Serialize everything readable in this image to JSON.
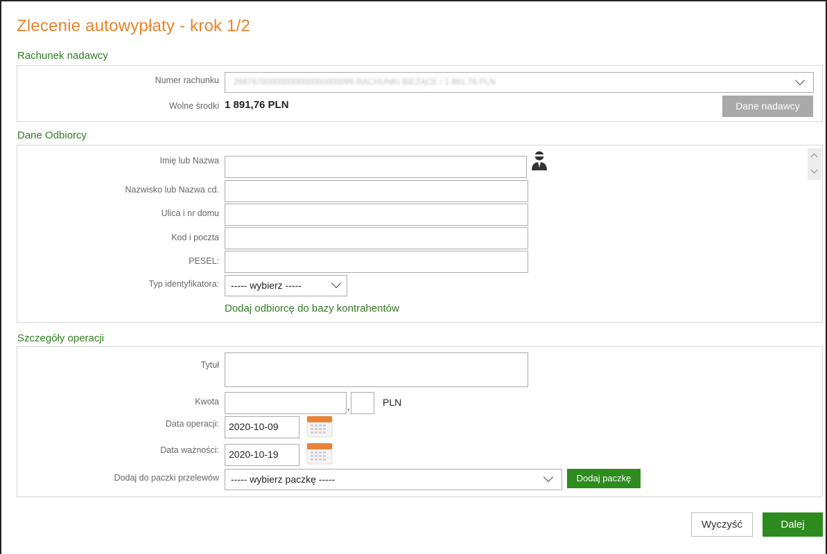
{
  "page": {
    "title": "Zlecenie autowypłaty - krok 1/2"
  },
  "sender": {
    "section_title": "Rachunek nadawcy",
    "account_label": "Numer rachunku",
    "account_value": "26878700000000000000000099 RACHUNKI BIEŻĄCE / 1 891,76 PLN",
    "funds_label": "Wolne środki",
    "funds_value": "1 891,76 PLN",
    "sender_data_button": "Dane nadawcy"
  },
  "recipient": {
    "section_title": "Dane Odbiorcy",
    "name_label": "Imię lub Nazwa",
    "name_value": "",
    "surname_label": "Nazwisko lub Nazwa cd.",
    "surname_value": "",
    "street_label": "Ulica i nr domu",
    "street_value": "",
    "postal_label": "Kod i poczta",
    "postal_value": "",
    "pesel_label": "PESEL:",
    "pesel_value": "",
    "id_type_label": "Typ identyfikatora:",
    "id_type_value": "----- wybierz -----",
    "add_to_contacts_link": "Dodaj odbiorcę do bazy kontrahentów"
  },
  "operation": {
    "section_title": "Szczegóły operacji",
    "title_label": "Tytuł",
    "title_value": "",
    "amount_label": "Kwota",
    "amount_whole": "",
    "amount_separator": ",",
    "amount_cents": "",
    "currency": "PLN",
    "date_label": "Data operacji:",
    "date_value": "2020-10-09",
    "expiry_label": "Data ważności:",
    "expiry_value": "2020-10-19",
    "package_label": "Dodaj do paczki przelewów",
    "package_value": "----- wybierz paczkę -----",
    "add_package_button": "Dodaj paczkę"
  },
  "footer": {
    "clear_button": "Wyczyść",
    "next_button": "Dalej"
  },
  "icons": {
    "contact_book": "person-icon",
    "calendar": "calendar-icon",
    "chevron": "chevron-down-icon"
  },
  "colors": {
    "title_orange": "#e8832a",
    "section_green": "#2e7d1e",
    "button_green": "#2e8b1e",
    "button_gray": "#a9a9a9"
  }
}
